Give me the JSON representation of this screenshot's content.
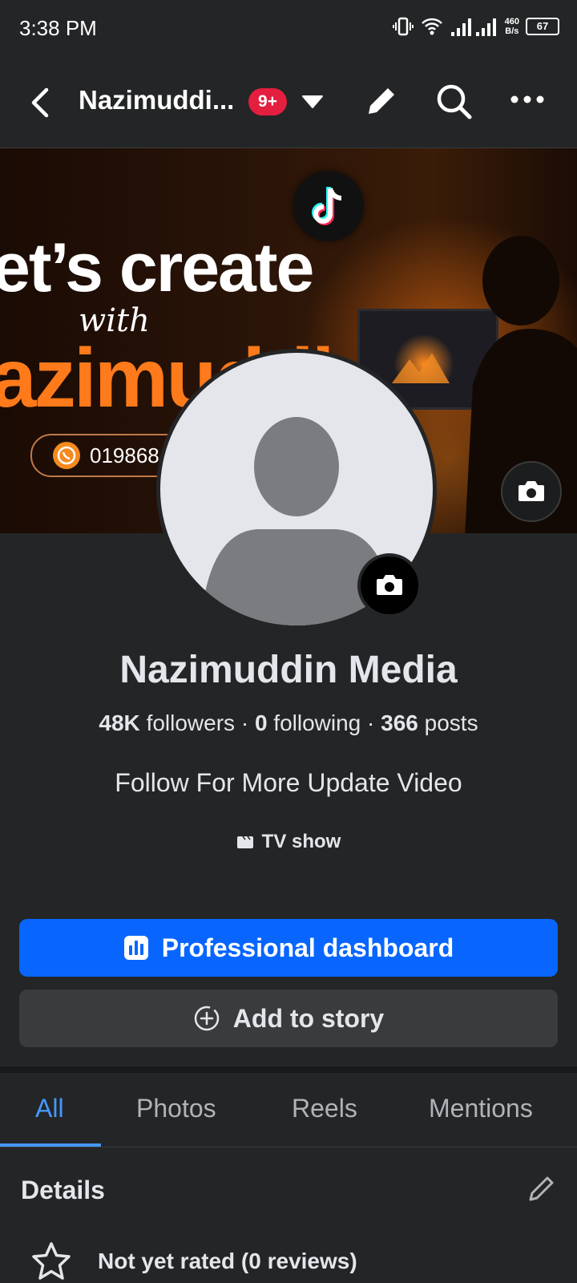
{
  "status_bar": {
    "time": "3:38 PM",
    "speed_value": "460",
    "speed_unit": "B/s",
    "battery": "67"
  },
  "header": {
    "title": "Nazimuddi...",
    "badge": "9+"
  },
  "cover": {
    "headline": "et’s create",
    "with": "with",
    "name": "azimuddi",
    "phone": "019868"
  },
  "profile": {
    "name": "Nazimuddin Media",
    "followers_count": "48K",
    "followers_label": "followers",
    "following_count": "0",
    "following_label": "following",
    "posts_count": "366",
    "posts_label": "posts",
    "separator": " · ",
    "bio": "Follow For More Update Video",
    "category": "TV show"
  },
  "buttons": {
    "dashboard": "Professional dashboard",
    "add_story": "Add to story"
  },
  "tabs": [
    {
      "label": "All",
      "active": true
    },
    {
      "label": "Photos",
      "active": false
    },
    {
      "label": "Reels",
      "active": false
    },
    {
      "label": "Mentions",
      "active": false
    }
  ],
  "details": {
    "title": "Details",
    "rating": "Not yet rated (0 reviews)"
  },
  "colors": {
    "background": "#242526",
    "primary_button": "#0866ff",
    "secondary_button": "#3a3b3c",
    "active_tab": "#4599ff",
    "badge": "#e41e3f",
    "cover_accent": "#ff7a1a"
  }
}
